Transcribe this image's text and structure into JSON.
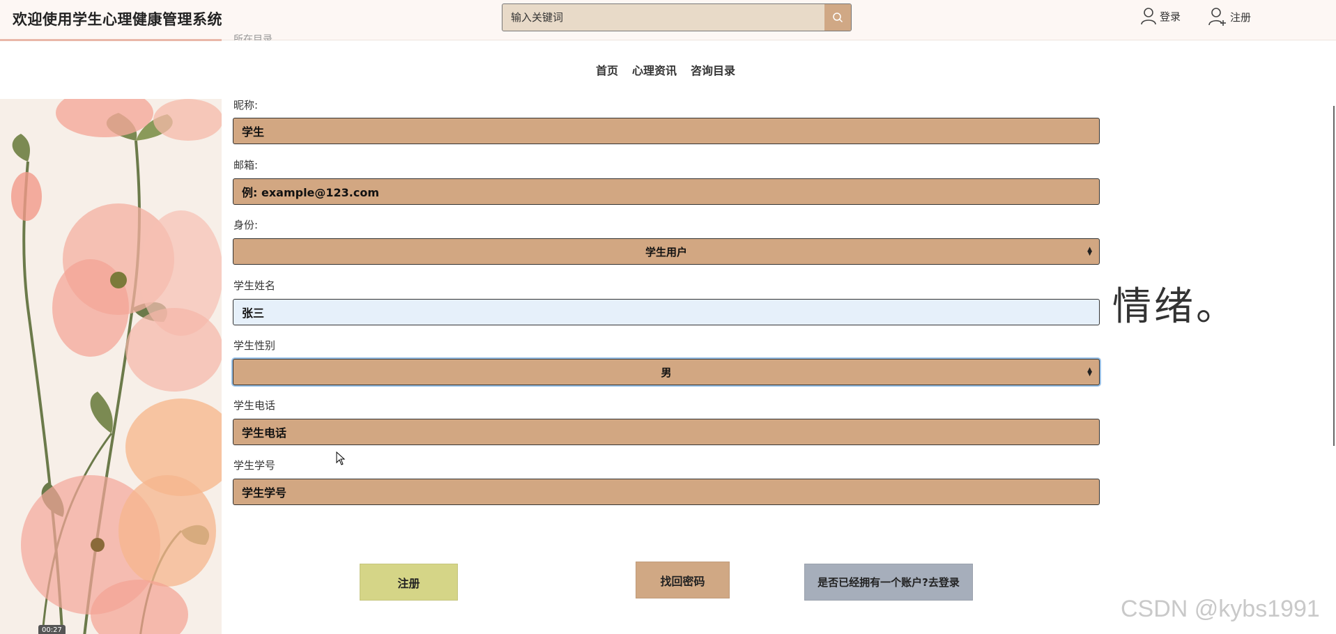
{
  "header": {
    "title": "欢迎使用学生心理健康管理系统",
    "search_placeholder": "输入关键词",
    "login_label": "登录",
    "register_label": "注册"
  },
  "nav": {
    "items": [
      "首页",
      "心理资讯",
      "咨询目录"
    ]
  },
  "faded_text": "所在目录",
  "form": {
    "nickname_label": "昵称:",
    "nickname_value": "学生",
    "email_label": "邮箱:",
    "email_value": "例: example@123.com",
    "role_label": "身份:",
    "role_value": "学生用户",
    "name_label": "学生姓名",
    "name_value": "张三",
    "gender_label": "学生性别",
    "gender_value": "男",
    "phone_label": "学生电话",
    "phone_value": "学生电话",
    "student_id_label": "学生学号",
    "student_id_value": "学生学号"
  },
  "buttons": {
    "register": "注册",
    "recover": "找回密码",
    "to_login": "是否已经拥有一个账户?去登录"
  },
  "decor": {
    "mood_text": "情绪。",
    "watermark": "CSDN @kybs1991",
    "video_time": "00:27"
  }
}
